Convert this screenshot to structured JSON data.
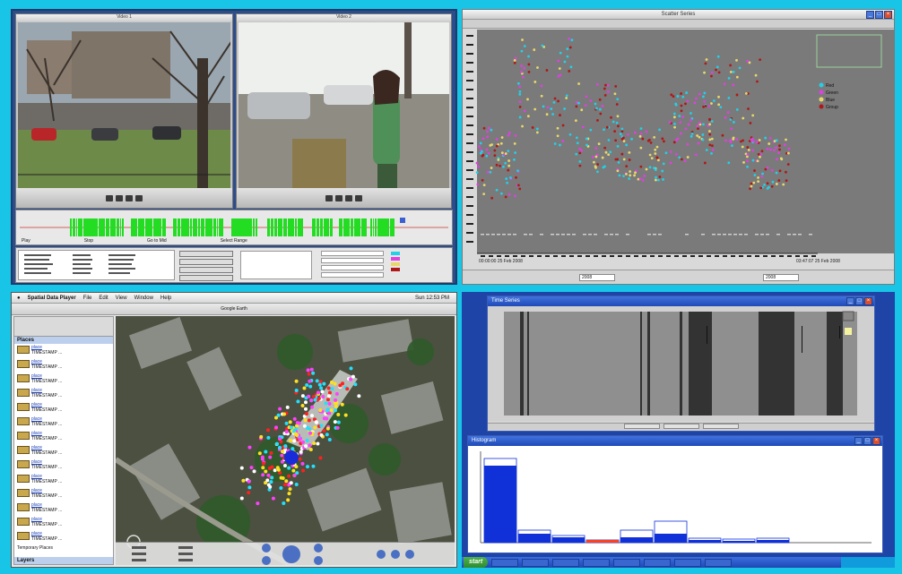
{
  "video_left": {
    "title": "Video 1"
  },
  "video_right": {
    "title": "Video 2"
  },
  "timeline": {
    "left_label": "Play",
    "mid_labels": [
      "Stop",
      "Go to Mid"
    ],
    "right_label": "Select Range"
  },
  "scatter_window": {
    "title": "Scatter Series",
    "legend": [
      {
        "name": "Red",
        "color": "#22d0e8"
      },
      {
        "name": "Green",
        "color": "#e040e0"
      },
      {
        "name": "Blue",
        "color": "#e8d86a"
      },
      {
        "name": "Group",
        "color": "#b01818"
      }
    ],
    "x_left_label": "00:00:00 25 Feb 2008",
    "x_right_label": "03:47:07 25 Feb 2008",
    "bottom_left_field": "2008",
    "bottom_right_field": "2008"
  },
  "app": {
    "name": "Spatial Data Player",
    "menu": [
      "File",
      "Edit",
      "View",
      "Window",
      "Help"
    ],
    "clock": "Sun 12:53 PM",
    "window_title": "Google Earth",
    "places_header": "Places",
    "places": [
      {
        "name": "place",
        "desc": "TIMESTAMP ..."
      },
      {
        "name": "place",
        "desc": "TIMESTAMP ..."
      },
      {
        "name": "place",
        "desc": "TIMESTAMP ..."
      },
      {
        "name": "place",
        "desc": "TIMESTAMP ..."
      },
      {
        "name": "place",
        "desc": "TIMESTAMP ..."
      },
      {
        "name": "place",
        "desc": "TIMESTAMP ..."
      },
      {
        "name": "place",
        "desc": "TIMESTAMP ..."
      },
      {
        "name": "place",
        "desc": "TIMESTAMP ..."
      },
      {
        "name": "place",
        "desc": "TIMESTAMP ..."
      },
      {
        "name": "place",
        "desc": "TIMESTAMP ..."
      },
      {
        "name": "place",
        "desc": "TIMESTAMP ..."
      },
      {
        "name": "place",
        "desc": "TIMESTAMP ..."
      },
      {
        "name": "place",
        "desc": "TIMESTAMP ..."
      },
      {
        "name": "place",
        "desc": "TIMESTAMP ..."
      }
    ],
    "temporary_places": "Temporary Places",
    "layers": "Layers"
  },
  "time_series": {
    "title": "Time Series"
  },
  "histogram": {
    "title": "Histogram"
  },
  "taskbar": {
    "start": "start"
  }
}
